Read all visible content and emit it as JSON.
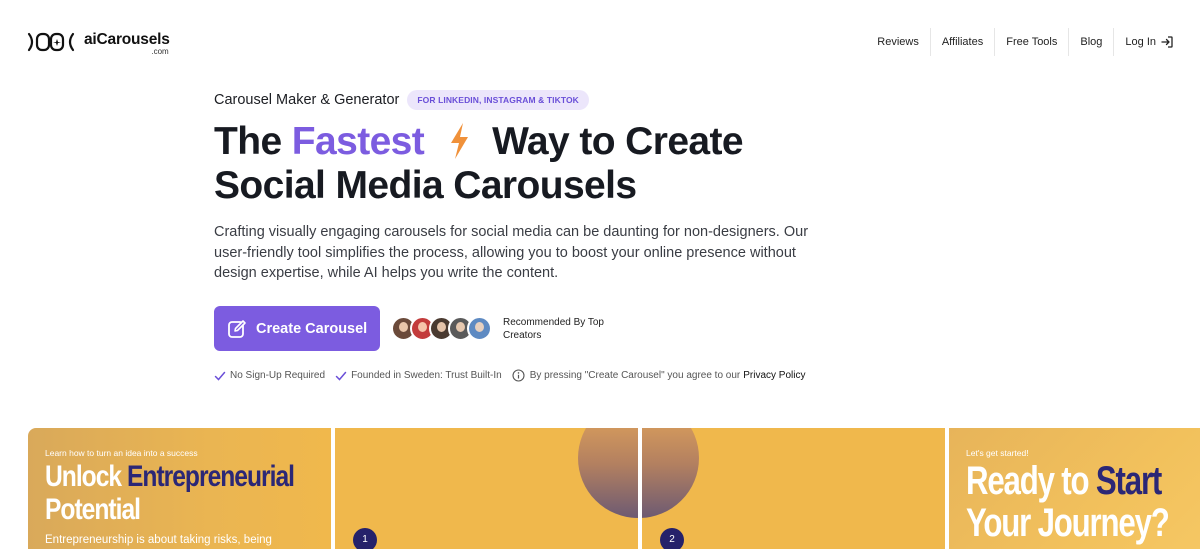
{
  "brand": {
    "name": "aiCarousels",
    "tld": ".com"
  },
  "nav": {
    "items": [
      {
        "label": "Reviews"
      },
      {
        "label": "Affiliates"
      },
      {
        "label": "Free Tools"
      },
      {
        "label": "Blog"
      }
    ],
    "login_label": "Log In"
  },
  "hero": {
    "subtitle": "Carousel Maker & Generator",
    "badge": "FOR LINKEDIN, INSTAGRAM & TIKTOK",
    "headline_pre": "The",
    "headline_accent": "Fastest",
    "headline_post": "Way to Create",
    "headline_line2": "Social Media Carousels",
    "description": "Crafting visually engaging carousels for social media can be daunting for non-designers. Our user-friendly tool simplifies the process, allowing you to boost your online presence without design expertise, while AI helps you write the content.",
    "cta_label": "Create Carousel",
    "recommended": "Recommended By Top Creators",
    "checks": [
      "No Sign-Up Required",
      "Founded in Sweden: Trust Built-In"
    ],
    "agreement": "By pressing \"Create Carousel\" you agree to our",
    "privacy_link": "Privacy Policy"
  },
  "slides": {
    "slide1": {
      "kicker": "Learn how to turn an idea into a success",
      "title_white": "Unlock",
      "title_dark": "Entrepreneurial",
      "title_line2": "Potential",
      "body": "Entrepreneurship is about taking risks, being"
    },
    "slide2": {
      "number": "1"
    },
    "slide3": {
      "number": "2"
    },
    "slide4": {
      "kicker": "Let's get started!",
      "title_white": "Ready to",
      "title_dark": "Start",
      "title_line2": "Your Journey?"
    }
  },
  "colors": {
    "accent": "#7c5ce0",
    "badge_bg": "#ece6fb",
    "bolt": "#f0913a",
    "slide_bg": "#f0b84c",
    "slide_dark": "#2b2776"
  },
  "avatars": [
    "creator-1",
    "creator-2",
    "creator-3",
    "creator-4",
    "creator-5"
  ]
}
